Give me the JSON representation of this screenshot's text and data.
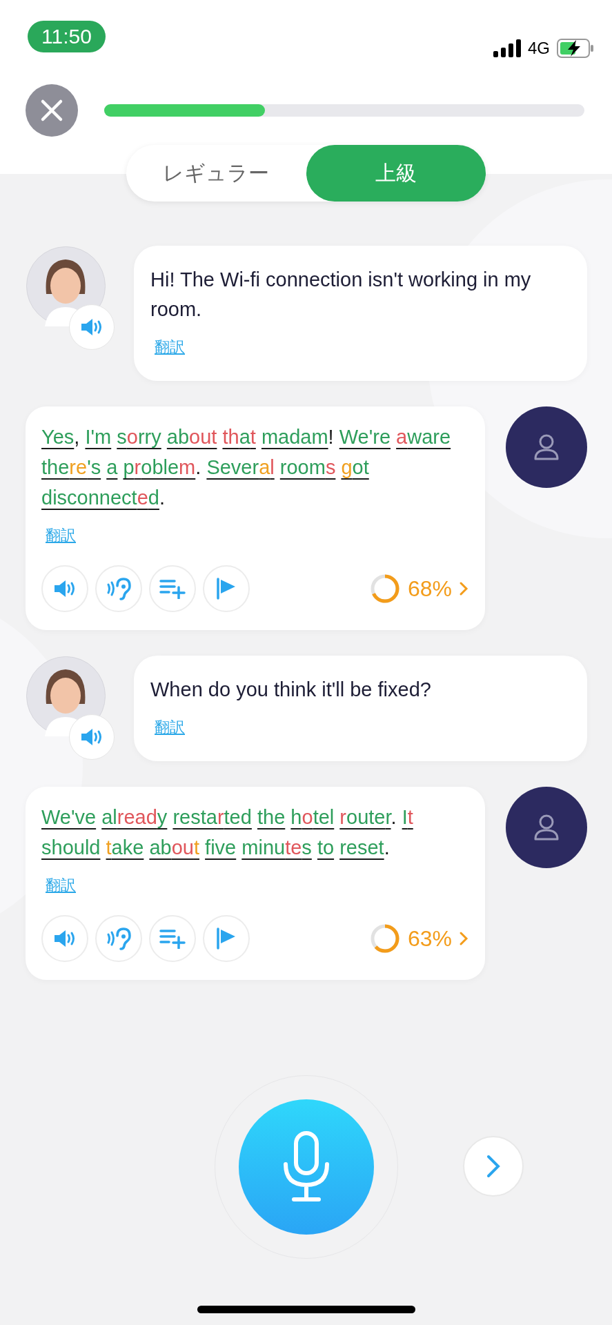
{
  "status_bar": {
    "time": "11:50",
    "network": "4G"
  },
  "header": {
    "progress": {
      "level": 0.335
    }
  },
  "mode_tabs": [
    {
      "label": "レギュラー",
      "selected": false
    },
    {
      "label": "上級",
      "selected": true
    }
  ],
  "messages": [
    {
      "kind": "bot",
      "text": "Hi! The Wi-fi connection isn't working in my room.",
      "translate": "翻訳"
    },
    {
      "kind": "user",
      "translate": "翻訳",
      "score": {
        "text": "68%",
        "level": 0.68
      },
      "words": [
        {
          "parts": [
            {
              "text": "Yes",
              "color": "#2e9e5b"
            }
          ],
          "punct": ","
        },
        {
          "parts": [
            {
              "text": "I'm",
              "color": "#2e9e5b"
            }
          ]
        },
        {
          "parts": [
            {
              "text": "s",
              "color": "#2e9e5b"
            },
            {
              "text": "o",
              "color": "#e0565b"
            },
            {
              "text": "rry",
              "color": "#2e9e5b"
            }
          ]
        },
        {
          "parts": [
            {
              "text": "ab",
              "color": "#2e9e5b"
            },
            {
              "text": "out",
              "color": "#e0565b"
            }
          ]
        },
        {
          "parts": [
            {
              "text": "th",
              "color": "#e0565b"
            },
            {
              "text": "a",
              "color": "#2e9e5b"
            },
            {
              "text": "t",
              "color": "#e0565b"
            }
          ]
        },
        {
          "parts": [
            {
              "text": "madam",
              "color": "#2e9e5b"
            }
          ],
          "punct": "!"
        },
        {
          "parts": [
            {
              "text": "We're",
              "color": "#2e9e5b"
            }
          ]
        },
        {
          "parts": [
            {
              "text": "a",
              "color": "#e0565b"
            },
            {
              "text": "ware",
              "color": "#2e9e5b"
            }
          ]
        },
        {
          "parts": [
            {
              "text": "the",
              "color": "#2e9e5b"
            },
            {
              "text": "re",
              "color": "#f0a020"
            },
            {
              "text": "'s",
              "color": "#2e9e5b"
            }
          ]
        },
        {
          "parts": [
            {
              "text": "a",
              "color": "#2e9e5b"
            }
          ]
        },
        {
          "parts": [
            {
              "text": "p",
              "color": "#2e9e5b"
            },
            {
              "text": "r",
              "color": "#e0565b"
            },
            {
              "text": "oble",
              "color": "#2e9e5b"
            },
            {
              "text": "m",
              "color": "#e0565b"
            }
          ],
          "punct": "."
        },
        {
          "parts": [
            {
              "text": "Sever",
              "color": "#2e9e5b"
            },
            {
              "text": "a",
              "color": "#f0a020"
            },
            {
              "text": "l",
              "color": "#e0565b"
            }
          ]
        },
        {
          "parts": [
            {
              "text": "room",
              "color": "#2e9e5b"
            },
            {
              "text": "s",
              "color": "#e0565b"
            }
          ]
        },
        {
          "parts": [
            {
              "text": "g",
              "color": "#f0a020"
            },
            {
              "text": "ot",
              "color": "#2e9e5b"
            }
          ]
        },
        {
          "parts": [
            {
              "text": "disconnect",
              "color": "#2e9e5b"
            },
            {
              "text": "e",
              "color": "#e0565b"
            },
            {
              "text": "d",
              "color": "#2e9e5b"
            }
          ],
          "punct": "."
        }
      ]
    },
    {
      "kind": "bot",
      "text": "When do you think it'll be fixed?",
      "translate": "翻訳"
    },
    {
      "kind": "user",
      "translate": "翻訳",
      "score": {
        "text": "63%",
        "level": 0.63
      },
      "words": [
        {
          "parts": [
            {
              "text": "We've",
              "color": "#2e9e5b"
            }
          ]
        },
        {
          "parts": [
            {
              "text": "al",
              "color": "#2e9e5b"
            },
            {
              "text": "read",
              "color": "#e0565b"
            },
            {
              "text": "y",
              "color": "#2e9e5b"
            }
          ]
        },
        {
          "parts": [
            {
              "text": "resta",
              "color": "#2e9e5b"
            },
            {
              "text": "r",
              "color": "#e0565b"
            },
            {
              "text": "ted",
              "color": "#2e9e5b"
            }
          ]
        },
        {
          "parts": [
            {
              "text": "the",
              "color": "#2e9e5b"
            }
          ]
        },
        {
          "parts": [
            {
              "text": "h",
              "color": "#2e9e5b"
            },
            {
              "text": "o",
              "color": "#e0565b"
            },
            {
              "text": "tel",
              "color": "#2e9e5b"
            }
          ]
        },
        {
          "parts": [
            {
              "text": "r",
              "color": "#e0565b"
            },
            {
              "text": "oute",
              "color": "#2e9e5b"
            },
            {
              "text": "r",
              "color": "#2e9e5b"
            }
          ],
          "punct": "."
        },
        {
          "parts": [
            {
              "text": "I",
              "color": "#2e9e5b"
            },
            {
              "text": "t",
              "color": "#e0565b"
            }
          ]
        },
        {
          "parts": [
            {
              "text": "should",
              "color": "#2e9e5b"
            }
          ]
        },
        {
          "parts": [
            {
              "text": "t",
              "color": "#f0a020"
            },
            {
              "text": "ake",
              "color": "#2e9e5b"
            }
          ]
        },
        {
          "parts": [
            {
              "text": "ab",
              "color": "#2e9e5b"
            },
            {
              "text": "ou",
              "color": "#e0565b"
            },
            {
              "text": "t",
              "color": "#f0a020"
            }
          ]
        },
        {
          "parts": [
            {
              "text": "five",
              "color": "#2e9e5b"
            }
          ]
        },
        {
          "parts": [
            {
              "text": "minu",
              "color": "#2e9e5b"
            },
            {
              "text": "te",
              "color": "#e0565b"
            },
            {
              "text": "s",
              "color": "#2e9e5b"
            }
          ]
        },
        {
          "parts": [
            {
              "text": "to",
              "color": "#2e9e5b"
            }
          ]
        },
        {
          "parts": [
            {
              "text": "reset",
              "color": "#2e9e5b"
            }
          ],
          "punct": "."
        }
      ]
    }
  ]
}
